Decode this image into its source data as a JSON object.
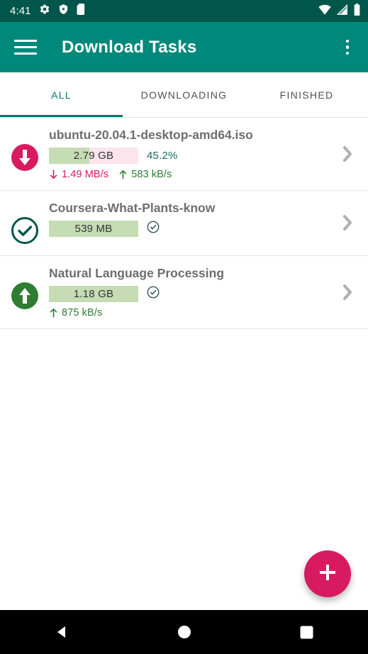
{
  "status_bar": {
    "time": "4:41",
    "left_icons": [
      "gear-icon",
      "shield-play-icon",
      "sd-card-icon"
    ],
    "right_icons": [
      "wifi-icon",
      "cellular-signal-icon",
      "battery-icon"
    ],
    "background": "#00564a"
  },
  "app_bar": {
    "title": "Download Tasks",
    "menu_icon": "hamburger-menu-icon",
    "overflow_icon": "overflow-menu-icon",
    "background": "#00897b"
  },
  "tabs": {
    "active_index": 0,
    "items": [
      {
        "label": "ALL"
      },
      {
        "label": "DOWNLOADING"
      },
      {
        "label": "FINISHED"
      }
    ],
    "accent": "#00796b"
  },
  "tasks": [
    {
      "name": "ubuntu-20.04.1-desktop-amd64.iso",
      "status_icon": "download-circle-icon",
      "status_icon_color": "#d81b60",
      "size": "2.79 GB",
      "percent_label": "45.2%",
      "percent_value": 45.2,
      "complete": false,
      "completed_badge": false,
      "download_speed": "1.49 MB/s",
      "upload_speed": "583 kB/s",
      "chevron_icon": "chevron-right-icon"
    },
    {
      "name": "Coursera-What-Plants-know",
      "status_icon": "check-circle-outline-icon",
      "status_icon_color": "#00564a",
      "size": "539 MB",
      "percent_label": "",
      "percent_value": 100,
      "complete": true,
      "completed_badge": true,
      "download_speed": "",
      "upload_speed": "",
      "chevron_icon": "chevron-right-icon"
    },
    {
      "name": "Natural Language Processing",
      "status_icon": "upload-circle-icon",
      "status_icon_color": "#2e7d32",
      "size": "1.18 GB",
      "percent_label": "",
      "percent_value": 100,
      "complete": true,
      "completed_badge": true,
      "download_speed": "",
      "upload_speed": "875 kB/s",
      "chevron_icon": "chevron-right-icon"
    }
  ],
  "fab": {
    "icon": "plus-icon",
    "color": "#d81b60"
  },
  "nav_bar": {
    "back_icon": "back-triangle-icon",
    "home_icon": "home-circle-icon",
    "recents_icon": "recents-square-icon"
  }
}
